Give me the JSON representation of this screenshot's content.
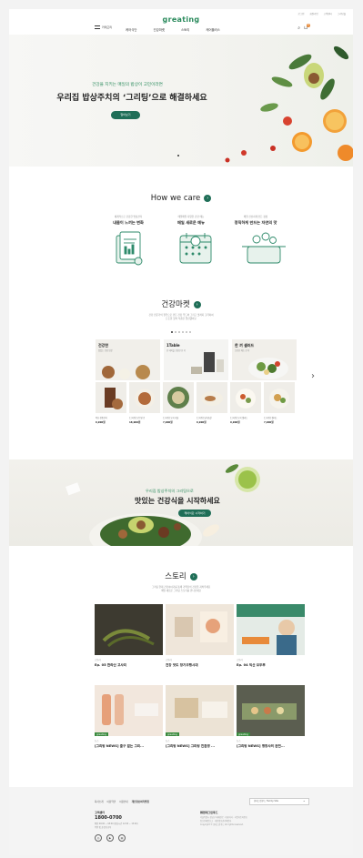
{
  "header": {
    "util_links": [
      "로그인",
      "회원가입",
      "고객센터",
      "그리팅몰"
    ],
    "logo": "greating",
    "category_label": "카테고리",
    "nav": [
      "케어식단",
      "건강마켓",
      "스토리",
      "케어플러스"
    ]
  },
  "hero": {
    "subtitle": "건강을 지키는 매일의 밥상이 고민이라면",
    "title": "우리집 밥상주치의 ‘그리팅’으로 해결하세요",
    "button": "알아보기"
  },
  "care": {
    "title": "How we care",
    "items": [
      {
        "sub": "체계적으로 건강한 밥상관리",
        "title": "내몸이 느끼는 변화"
      },
      {
        "sub": "매일매일 다양한 건강 메뉴",
        "title": "매일 새로운 메뉴"
      },
      {
        "sub": "매일 신선하게 만든 정성",
        "title": "정직하게 만드는 자연의 맛"
      }
    ]
  },
  "market": {
    "title": "건강마켓",
    "desc": [
      "건강 전문가의 철학으로 만든 건강 푸드와 그리고 맛까지 고려하여",
      "든든한 맛의 식품만 엄선했어요"
    ],
    "cards": [
      {
        "title": "건강한",
        "sub": "맛있는 건강 밥상"
      },
      {
        "title": "1Table",
        "sub": "한 테이블 건강한 한 끼"
      },
      {
        "title": "한 끼 샐러드",
        "sub": "신선한 채소 한 끼"
      }
    ],
    "products": [
      {
        "name": "육포·전통간식",
        "price": "6,900원"
      },
      {
        "name": "[그리팅] 오트밀 로",
        "price": "18,900원"
      },
      {
        "name": "[그리팅] 오곡·곡물",
        "price": "7,900원"
      },
      {
        "name": "[그리팅] 닭가슴살",
        "price": "6,900원"
      },
      {
        "name": "[그리팅] 오곡 샐러드",
        "price": "9,900원"
      },
      {
        "name": "[그리팅] 샐러드",
        "price": "7,900원"
      }
    ]
  },
  "banner": {
    "subtitle": "우리집 밥상주치의 그리팅으로",
    "title": "맛있는 건강식을 시작하세요",
    "button": "케어식단 시작하기"
  },
  "story": {
    "title": "스토리",
    "desc": [
      "그리팅 현대 건강이야기를 통해 가족들의 건강을 지켜주세요",
      "매일 새로운 그리팅 스토리를 만나보세요"
    ],
    "items": [
      {
        "tag": "스토리",
        "title": "Ep. 05 한라산 고사리",
        "label": ""
      },
      {
        "tag": "스토리",
        "title": "건강 맛도 장기주행시대",
        "label": ""
      },
      {
        "tag": "스토리",
        "title": "Ep. 04 익산 모두부",
        "label": ""
      },
      {
        "tag": "뉴스",
        "title": "[그리팅 NEWS] 출구 없는 그리...",
        "label": "greating"
      },
      {
        "tag": "뉴스",
        "title": "[그리팅 NEWS] 그리팅 친환경 ...",
        "label": "greating"
      },
      {
        "tag": "뉴스",
        "title": "[그리팅 NEWS] 맹장사의 완전...",
        "label": "greating"
      }
    ]
  },
  "footer": {
    "links": [
      "회사소개",
      "이용약관",
      "이용안내",
      "개인정보처리방침"
    ],
    "family_site": "현대그린푸드 Family Site",
    "cs_title": "고객센터",
    "cs_number": "1800-0700",
    "cs_hours": [
      "평일 09:00 ~ 18:00 (점심시간 12:00 ~ 13:00)",
      "주말 및 공휴일 휴무"
    ],
    "company": "㈜현대그린푸드",
    "info": [
      "서울특별시 강남구 테헤란로 · 대표이사 · 사업자등록번호",
      "통신판매업신고 · 개인정보관리책임자",
      "Copyright © 현대그린푸드 All rights reserved."
    ],
    "social": [
      "instagram-icon",
      "youtube-icon",
      "blog-icon"
    ]
  },
  "colors": {
    "brand": "#2a8a5c",
    "button": "#1f6e57"
  }
}
